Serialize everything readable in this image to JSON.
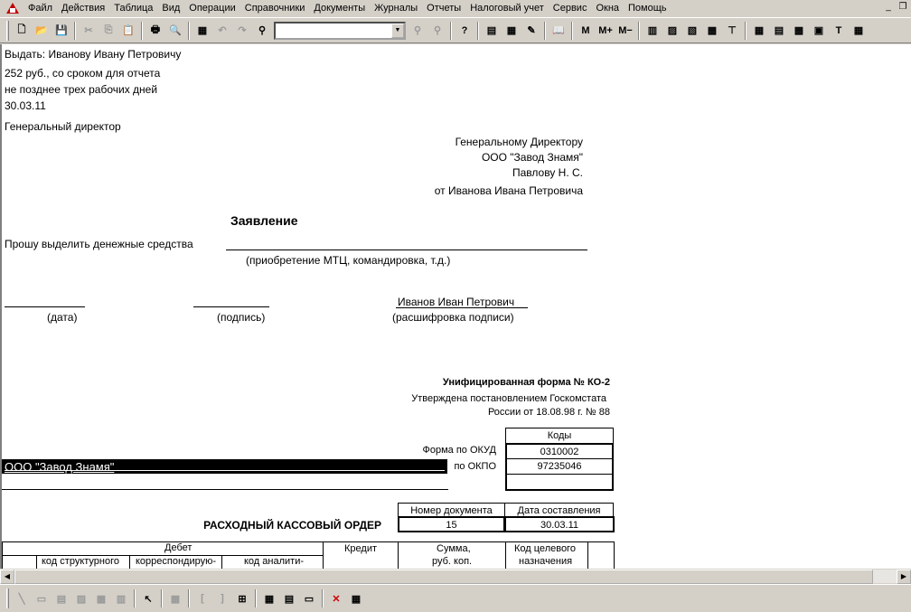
{
  "menu": {
    "items": [
      "Файл",
      "Действия",
      "Таблица",
      "Вид",
      "Операции",
      "Справочники",
      "Документы",
      "Журналы",
      "Отчеты",
      "Налоговый учет",
      "Сервис",
      "Окна",
      "Помощь"
    ]
  },
  "toolbar": {
    "search_value": "",
    "memory_buttons": [
      "M",
      "M+",
      "M−"
    ]
  },
  "statement": {
    "issue_line": "Выдать: Иванову Ивану Петровичу",
    "amount_line1": "252 руб., со сроком для отчета",
    "amount_line2": "не позднее трех рабочих дней",
    "date": "30.03.11",
    "director_label": "Генеральный директор",
    "addressee": {
      "line1": "Генеральному Директору",
      "line2": "ООО \"Завод Знамя\"",
      "line3": "Павлову Н. С.",
      "line4": "от Иванова Ивана Петровича"
    },
    "title": "Заявление",
    "request_text": "Прошу выделить денежные средства",
    "purpose_hint": "(приобретение МТЦ, командировка, т.д.)",
    "signer_name": "Иванов Иван Петрович",
    "date_caption": "(дата)",
    "signature_caption": "(подпись)",
    "decode_caption": "(расшифровка подписи)"
  },
  "form_ko2": {
    "unified_form": "Унифицированная форма № КО-2",
    "approved_line1": "Утверждена постановлением Госкомстата",
    "approved_line2": "России от 18.08.98 г. № 88",
    "codes_header": "Коды",
    "okud_label": "Форма по ОКУД",
    "okud_value": "0310002",
    "okpo_label": "по ОКПО",
    "okpo_value": "97235046",
    "organization": "ООО \"Завод Знамя\"",
    "doc_number_header": "Номер документа",
    "doc_date_header": "Дата составления",
    "doc_title": "РАСХОДНЫЙ КАССОВЫЙ ОРДЕР",
    "doc_number": "15",
    "doc_date": "30.03.11",
    "table": {
      "debit": "Дебет",
      "credit": "Кредит",
      "sum": "Сумма,",
      "sum2": "руб. коп.",
      "purpose_code": "Код целевого",
      "purpose_code2": "назначения",
      "struct_code": "код структурного",
      "corr": "корреспондирую-",
      "analytic": "код аналити-"
    }
  }
}
